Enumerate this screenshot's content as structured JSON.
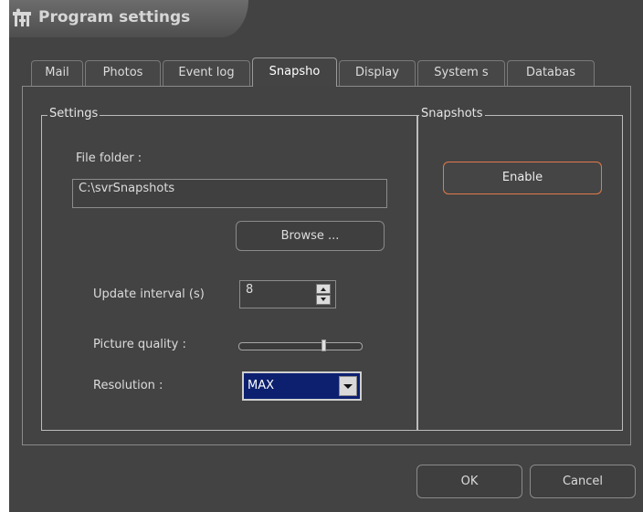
{
  "window": {
    "title": "Program settings",
    "icon": "settings-icon"
  },
  "tabs": [
    {
      "label": "Mail",
      "active": false
    },
    {
      "label": "Photos",
      "active": false
    },
    {
      "label": "Event log",
      "active": false
    },
    {
      "label": "Snapsho",
      "active": true
    },
    {
      "label": "Display",
      "active": false
    },
    {
      "label": "System s",
      "active": false
    },
    {
      "label": "Databas",
      "active": false
    }
  ],
  "settings": {
    "legend": "Settings",
    "file_folder_label": "File folder :",
    "file_folder_value": "C:\\svrSnapshots",
    "browse_label": "Browse ...",
    "update_interval_label": "Update interval (s)",
    "update_interval_value": "8",
    "picture_quality_label": "Picture quality :",
    "picture_quality_level": 0.7,
    "resolution_label": "Resolution :",
    "resolution_value": "MAX"
  },
  "snapshots": {
    "legend": "Snapshots",
    "enable_label": "Enable"
  },
  "footer": {
    "ok_label": "OK",
    "cancel_label": "Cancel"
  },
  "colors": {
    "background": "#434343",
    "accent": "#e07a4a",
    "select_bg": "#0d2070"
  }
}
